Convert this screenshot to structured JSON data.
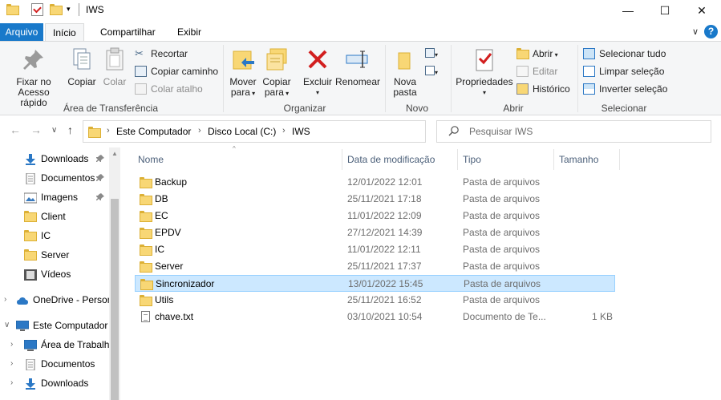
{
  "window": {
    "title": "IWS",
    "minimize": "—",
    "maximize": "☐",
    "close": "✕"
  },
  "tabs": {
    "file": "Arquivo",
    "home": "Início",
    "share": "Compartilhar",
    "view": "Exibir",
    "collapse": "∨",
    "help": "?"
  },
  "ribbon": {
    "clipboard": {
      "label": "Área de Transferência",
      "pin": [
        "Fixar no",
        "Acesso rápido"
      ],
      "copy": "Copiar",
      "paste": "Colar",
      "cut": "Recortar",
      "copy_path": "Copiar caminho",
      "paste_shortcut": "Colar atalho"
    },
    "organize": {
      "label": "Organizar",
      "move_to": [
        "Mover",
        "para"
      ],
      "copy_to": [
        "Copiar",
        "para"
      ],
      "delete": "Excluir",
      "rename": "Renomear"
    },
    "new": {
      "label": "Novo",
      "new_folder": [
        "Nova",
        "pasta"
      ]
    },
    "open": {
      "label": "Abrir",
      "properties": "Propriedades",
      "open": "Abrir",
      "edit": "Editar",
      "history": "Histórico"
    },
    "select": {
      "label": "Selecionar",
      "select_all": "Selecionar tudo",
      "clear": "Limpar seleção",
      "invert": "Inverter seleção"
    }
  },
  "address": {
    "crumbs": [
      "Este Computador",
      "Disco Local (C:)",
      "IWS"
    ],
    "sep": "›",
    "refresh": "↻",
    "dropdown": "∨"
  },
  "search": {
    "placeholder": "Pesquisar IWS"
  },
  "nav": {
    "back": "←",
    "forward": "→",
    "recent": "∨",
    "up": "↑",
    "pin_glyph": "📌",
    "items": [
      {
        "label": "Downloads",
        "pinned": true
      },
      {
        "label": "Documentos",
        "pinned": true
      },
      {
        "label": "Imagens",
        "pinned": true
      },
      {
        "label": "Client"
      },
      {
        "label": "IC"
      },
      {
        "label": "Server"
      },
      {
        "label": "Vídeos"
      },
      {
        "label": "OneDrive - Person"
      },
      {
        "label": "Este Computador"
      },
      {
        "label": "Área de Trabalho"
      },
      {
        "label": "Documentos"
      },
      {
        "label": "Downloads"
      }
    ]
  },
  "columns": {
    "name": "Nome",
    "date": "Data de modificação",
    "type": "Tipo",
    "size": "Tamanho",
    "sort_arrow": "^"
  },
  "files": [
    {
      "name": "Backup",
      "date": "12/01/2022 12:01",
      "type": "Pasta de arquivos",
      "size": "",
      "kind": "folder"
    },
    {
      "name": "DB",
      "date": "25/11/2021 17:18",
      "type": "Pasta de arquivos",
      "size": "",
      "kind": "folder"
    },
    {
      "name": "EC",
      "date": "11/01/2022 12:09",
      "type": "Pasta de arquivos",
      "size": "",
      "kind": "folder"
    },
    {
      "name": "EPDV",
      "date": "27/12/2021 14:39",
      "type": "Pasta de arquivos",
      "size": "",
      "kind": "folder"
    },
    {
      "name": "IC",
      "date": "11/01/2022 12:11",
      "type": "Pasta de arquivos",
      "size": "",
      "kind": "folder"
    },
    {
      "name": "Server",
      "date": "25/11/2021 17:37",
      "type": "Pasta de arquivos",
      "size": "",
      "kind": "folder"
    },
    {
      "name": "Sincronizador",
      "date": "13/01/2022 15:45",
      "type": "Pasta de arquivos",
      "size": "",
      "kind": "folder",
      "selected": true
    },
    {
      "name": "Utils",
      "date": "25/11/2021 16:52",
      "type": "Pasta de arquivos",
      "size": "",
      "kind": "folder"
    },
    {
      "name": "chave.txt",
      "date": "03/10/2021 10:54",
      "type": "Documento de Te...",
      "size": "1 KB",
      "kind": "txt"
    }
  ],
  "colors": {
    "accent": "#1979ca",
    "selection_bg": "#cce8ff",
    "selection_border": "#99d1ff",
    "folder": "#f8d775",
    "delete_red": "#d21f1f"
  }
}
